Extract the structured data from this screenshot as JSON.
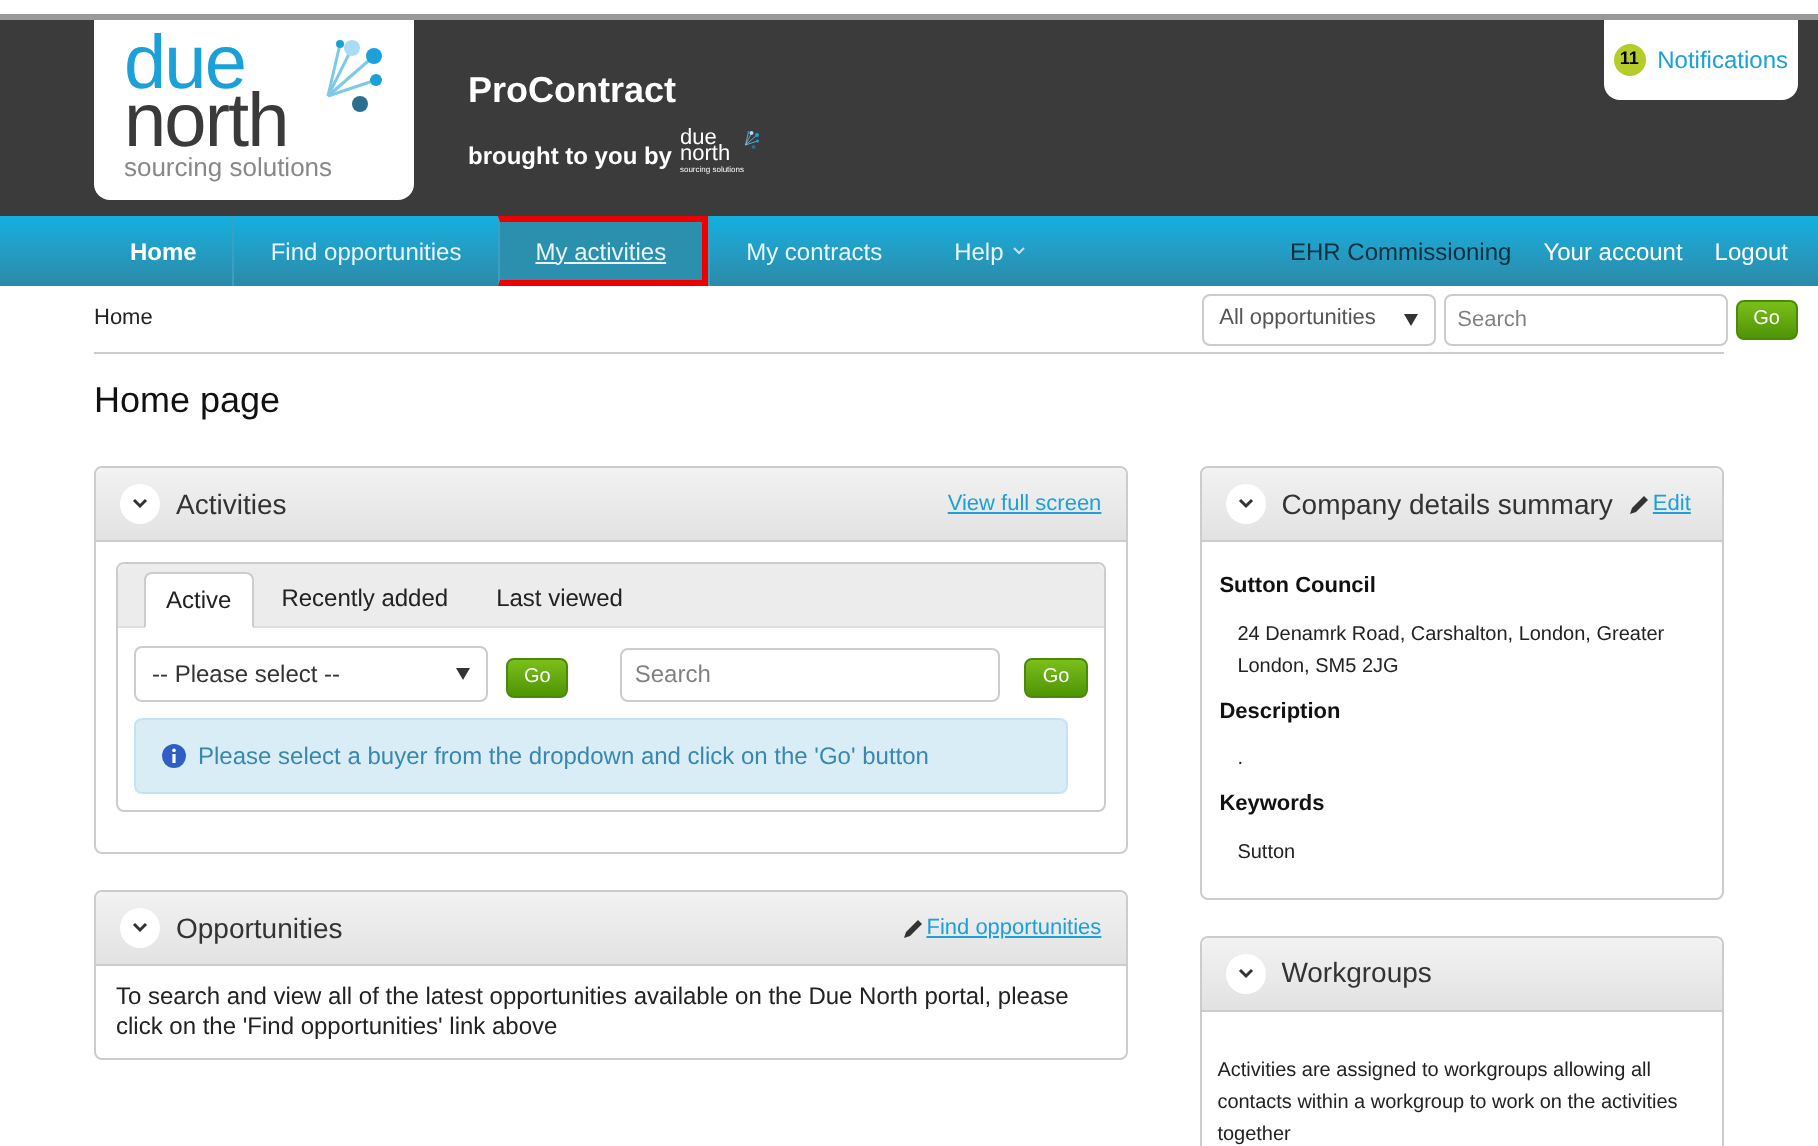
{
  "header": {
    "logo": {
      "line1": "due",
      "line2": "north",
      "tagline": "sourcing solutions"
    },
    "title": "ProContract",
    "brought_by": "brought to you by",
    "small_logo": {
      "line1": "due",
      "line2": "north",
      "tagline": "sourcing solutions"
    },
    "notifications": {
      "count": "11",
      "label": "Notifications"
    }
  },
  "nav": {
    "items": [
      {
        "label": "Home",
        "selected": true,
        "highlighted": false,
        "has_caret": false
      },
      {
        "label": "Find opportunities",
        "selected": false,
        "highlighted": false,
        "has_caret": false
      },
      {
        "label": "My activities",
        "selected": false,
        "highlighted": true,
        "has_caret": false
      },
      {
        "label": "My contracts",
        "selected": false,
        "highlighted": false,
        "has_caret": false
      },
      {
        "label": "Help",
        "selected": false,
        "highlighted": false,
        "has_caret": true
      }
    ],
    "right_items": [
      "EHR Commissioning",
      "Your account",
      "Logout"
    ]
  },
  "breadcrumb": "Home",
  "top_search": {
    "scope": "All opportunities",
    "placeholder": "Search",
    "button": "Go"
  },
  "page_title": "Home page",
  "activities": {
    "title": "Activities",
    "link": "View full screen",
    "tabs": [
      {
        "label": "Active",
        "selected": true
      },
      {
        "label": "Recently added",
        "selected": false
      },
      {
        "label": "Last viewed",
        "selected": false
      }
    ],
    "select": "-- Please select --",
    "go1": "Go",
    "search_placeholder": "Search",
    "go2": "Go",
    "info": "Please select a buyer from the dropdown and click on the 'Go' button"
  },
  "opportunities": {
    "title": "Opportunities",
    "link": "Find opportunities",
    "text": "To search and view all of the latest opportunities available on the Due North portal, please click on the 'Find opportunities' link above"
  },
  "company": {
    "title": "Company details summary",
    "edit": "Edit",
    "sections": [
      {
        "heading": "Sutton Council",
        "text": "24 Denamrk Road, Carshalton, London, Greater London, SM5 2JG"
      },
      {
        "heading": "Description",
        "text": "."
      },
      {
        "heading": "Keywords",
        "text": "Sutton"
      }
    ]
  },
  "workgroups": {
    "title": "Workgroups",
    "text": "Activities are assigned to workgroups allowing all contacts within a workgroup to work on the activities together"
  }
}
